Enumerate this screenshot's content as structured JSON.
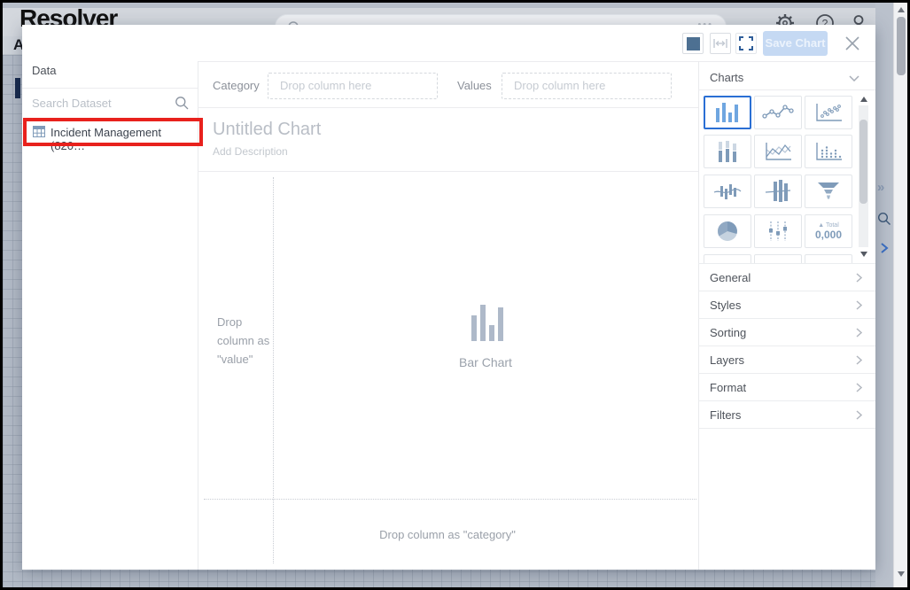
{
  "page": {
    "logo": "Resolver",
    "nav_letter": "A",
    "search_dots": "•••"
  },
  "modal": {
    "toolbar": {
      "save_label": "Save Chart"
    },
    "data_panel": {
      "title": "Data",
      "search_placeholder": "Search Dataset",
      "dataset_item": "Incident Management (820…"
    },
    "builder": {
      "category_label": "Category",
      "category_placeholder": "Drop column here",
      "values_label": "Values",
      "values_placeholder": "Drop column here",
      "title_placeholder": "Untitled Chart",
      "description_placeholder": "Add Description",
      "value_hint": "Drop column as \"value\"",
      "category_hint": "Drop column as \"category\"",
      "selected_chart_label": "Bar Chart"
    },
    "charts_panel": {
      "header": "Charts",
      "tiles": [
        {
          "name": "bar-chart",
          "selected": true
        },
        {
          "name": "line-chart",
          "selected": false
        },
        {
          "name": "scatter-plot",
          "selected": false
        },
        {
          "name": "stacked-column-chart",
          "selected": false
        },
        {
          "name": "multi-line-chart",
          "selected": false
        },
        {
          "name": "dot-column-chart",
          "selected": false
        },
        {
          "name": "bar-line-chart",
          "selected": false
        },
        {
          "name": "column-line-chart",
          "selected": false
        },
        {
          "name": "funnel-chart",
          "selected": false
        },
        {
          "name": "pie-chart",
          "selected": false
        },
        {
          "name": "candlestick-chart",
          "selected": false
        },
        {
          "name": "kpi-metric",
          "selected": false
        }
      ],
      "kpi_tile": {
        "trend": "▲ Total",
        "value": "0,000"
      },
      "sections": [
        "General",
        "Styles",
        "Sorting",
        "Layers",
        "Format",
        "Filters"
      ]
    }
  },
  "colors": {
    "accent_blue": "#2a6fd4",
    "icon_slate": "#7f9bb9",
    "selected_icon_blue": "#6fa6e0",
    "annotation_red": "#e8211d",
    "save_button_bg": "#c5d9f3",
    "swatch_fill": "#4d7092",
    "canvas_gray": "#b3bbc7"
  }
}
